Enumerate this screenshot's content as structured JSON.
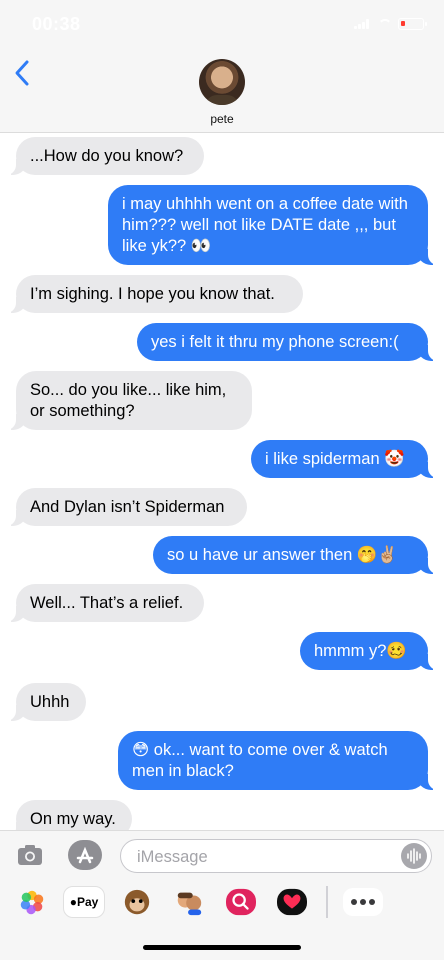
{
  "status_bar": {
    "time": "00:38"
  },
  "header": {
    "contact_name": "pete"
  },
  "messages": [
    {
      "dir": "in",
      "text": "...How do you know?"
    },
    {
      "dir": "out",
      "text": "i may uhhhh went on a coffee date with him??? well not like DATE date ,,, but like yk?? 👀"
    },
    {
      "dir": "in",
      "text": "I’m sighing. I hope you know that."
    },
    {
      "dir": "out",
      "text": "yes i felt it thru my phone screen:("
    },
    {
      "dir": "in",
      "text": "So... do you like... like him, or something?"
    },
    {
      "dir": "out",
      "text": "i like spiderman 🤡"
    },
    {
      "dir": "in",
      "text": "And Dylan isn’t Spiderman"
    },
    {
      "dir": "out",
      "text": "so u have ur answer then 🤭✌🏼"
    },
    {
      "dir": "in",
      "text": "Well... That’s a relief."
    },
    {
      "dir": "out",
      "text": "hmmm y?🥴"
    },
    {
      "dir": "in",
      "text": "Uhhh"
    },
    {
      "dir": "out",
      "text": "😳 ok... want to come over & watch men in black?"
    },
    {
      "dir": "in",
      "text": "On my way."
    }
  ],
  "compose": {
    "placeholder": "iMessage"
  },
  "app_drawer": {
    "apple_pay_label": "Pay",
    "apps": [
      "photos-icon",
      "apple-pay-icon",
      "monkey-memoji-icon",
      "memoji-stickers-icon",
      "image-search-icon",
      "digital-touch-icon",
      "more-icon"
    ]
  },
  "colors": {
    "outgoing": "#2f7cf6",
    "incoming": "#e9e9eb",
    "accent": "#2f7cf6"
  }
}
